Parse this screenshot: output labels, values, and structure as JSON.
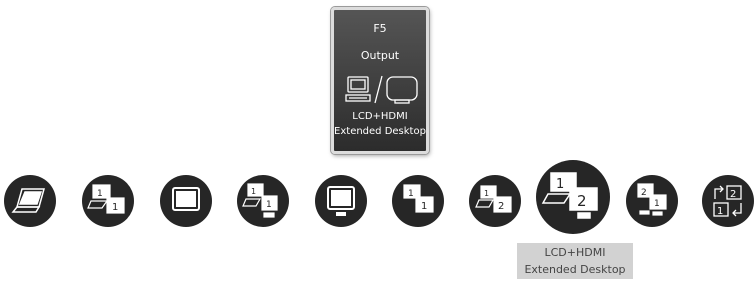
{
  "osd": {
    "hotkey": "F5",
    "function": "Output",
    "mode_line1": "LCD+HDMI",
    "mode_line2": "Extended Desktop",
    "icon": "lcd-slash-external-monitor-icon"
  },
  "modes": [
    {
      "icon": "laptop-icon"
    },
    {
      "icon": "laptop-and-monitor-1-icon"
    },
    {
      "icon": "external-monitor-icon"
    },
    {
      "icon": "laptop-and-hdmi-1-icon"
    },
    {
      "icon": "hdmi-monitor-icon"
    },
    {
      "icon": "dual-monitor-1-1-icon"
    },
    {
      "icon": "laptop-and-monitor-extended-icon"
    },
    {
      "icon": "lcd-hdmi-extended-icon",
      "selected": true
    },
    {
      "icon": "dual-monitor-2-1-hdmi-icon"
    },
    {
      "icon": "swap-displays-icon"
    }
  ],
  "selected_caption": {
    "line1": "LCD+HDMI",
    "line2": "Extended Desktop"
  },
  "colors": {
    "button_bg": "#262626",
    "caption_bg": "#d2d2d2",
    "osd_bg": "#3c3c3c"
  }
}
